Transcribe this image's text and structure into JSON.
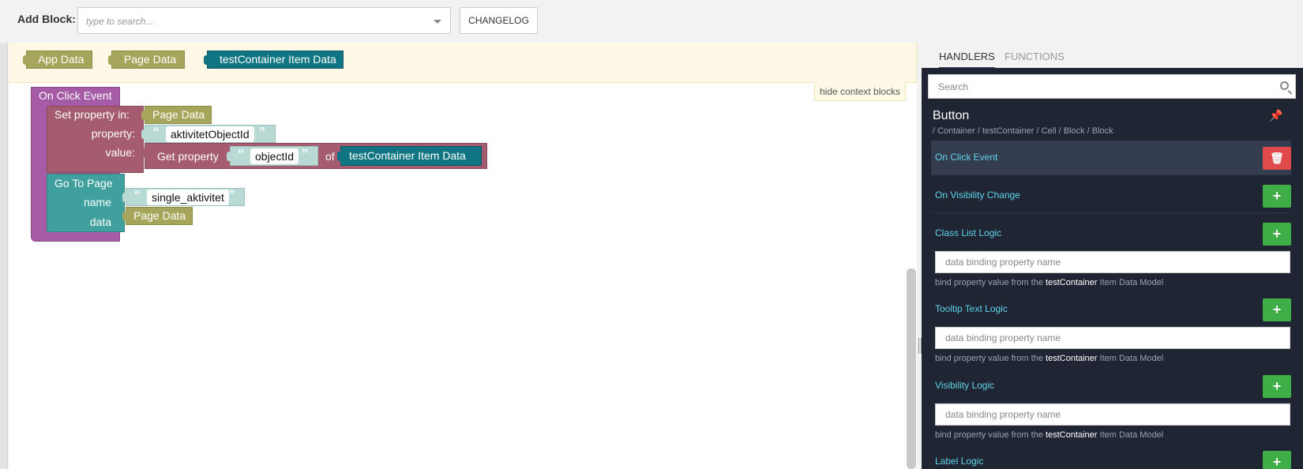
{
  "toolbar": {
    "add_block_label": "Add Block:",
    "search_placeholder": "type to search...",
    "changelog_label": "CHANGELOG"
  },
  "context_blocks": {
    "app_data": "App Data",
    "page_data": "Page Data",
    "container_item_data": "testContainer Item Data",
    "hide_label": "hide context blocks"
  },
  "blocks": {
    "on_click_event": "On Click Event",
    "set_property_in": "Set property in:",
    "set_target": "Page Data",
    "property_label": "property:",
    "property_value": "aktivitetObjectId",
    "value_label": "value:",
    "get_property": "Get property",
    "get_property_key": "objectId",
    "of_label": "of",
    "get_property_source": "testContainer Item Data",
    "go_to_page": "Go To Page",
    "name_label": "name",
    "page_name": "single_aktivitet",
    "data_label": "data",
    "data_value": "Page Data"
  },
  "panel": {
    "tabs": [
      "HANDLERS",
      "FUNCTIONS"
    ],
    "search_placeholder": "Search",
    "block_title": "Button",
    "block_path": "/ Container / testContainer / Cell / Block / Block",
    "handlers": [
      {
        "name": "On Click Event"
      },
      {
        "name": "On Visibility Change"
      },
      {
        "name": "Class List Logic",
        "input_placeholder": "data binding property name",
        "hint_pre": "bind property value from the",
        "hint_container": "testContainer",
        "hint_post": "Item Data Model"
      },
      {
        "name": "Tooltip Text Logic",
        "input_placeholder": "data binding property name",
        "hint_pre": "bind property value from the",
        "hint_container": "testContainer",
        "hint_post": "Item Data Model"
      },
      {
        "name": "Visibility Logic",
        "input_placeholder": "data binding property name",
        "hint_pre": "bind property value from the",
        "hint_container": "testContainer",
        "hint_post": "Item Data Model"
      },
      {
        "name": "Label Logic"
      }
    ],
    "add_symbol": "+",
    "delete_symbol": "🗑"
  },
  "colors": {
    "event_block": "#a55ba5",
    "variable_block": "#a5a55b",
    "set_block": "#a55b70",
    "text_block": "#b8d9d4",
    "container_block": "#107583",
    "navigation_block": "#40a09e",
    "panel_dark": "#1f2532",
    "accent_cyan": "#5fd3ea",
    "add_green": "#3fae47",
    "delete_red": "#e04a4a"
  }
}
